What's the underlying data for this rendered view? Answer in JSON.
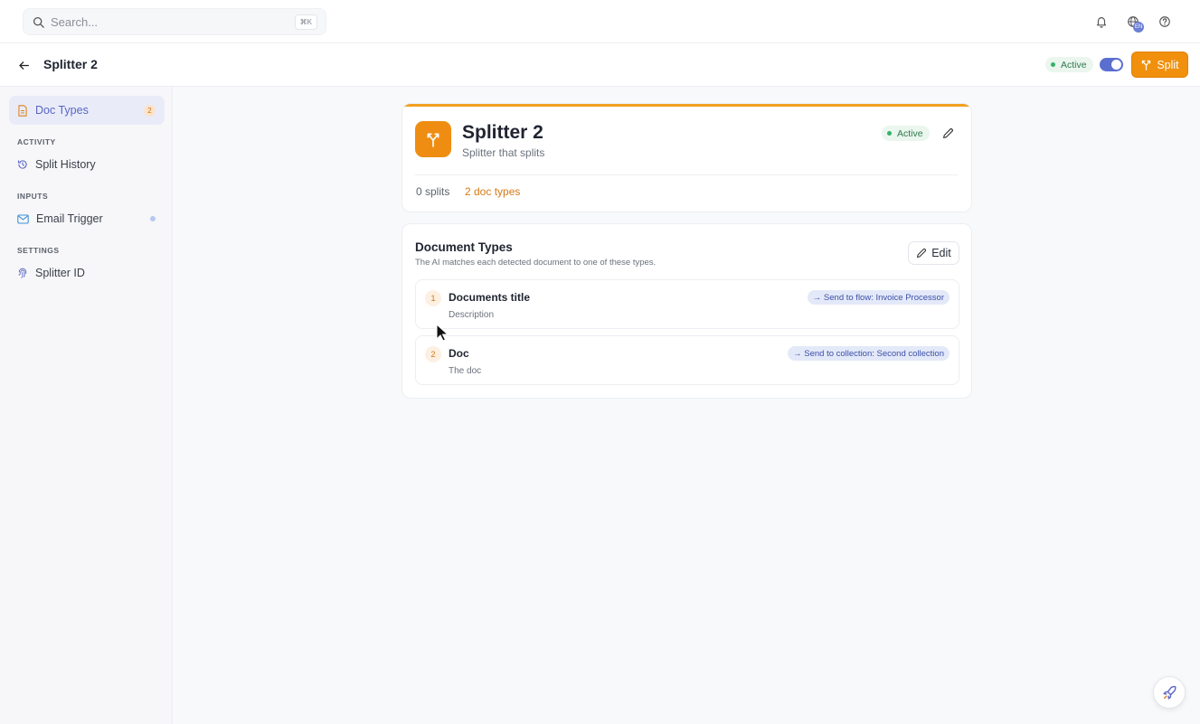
{
  "search": {
    "placeholder": "Search...",
    "shortcut": "⌘K"
  },
  "topbar": {
    "language_badge": "EN"
  },
  "header": {
    "title": "Splitter 2",
    "status": "Active",
    "toggle_on": true,
    "split_label": "Split"
  },
  "sidebar": {
    "items": [
      {
        "label": "Doc Types",
        "count": "2",
        "icon": "document-icon",
        "active": true
      },
      {
        "section": "ACTIVITY",
        "label": "Split History",
        "icon": "history-icon"
      },
      {
        "section": "INPUTS",
        "label": "Email Trigger",
        "icon": "mail-icon"
      },
      {
        "section": "SETTINGS",
        "label": "Splitter ID",
        "icon": "fingerprint-icon"
      }
    ]
  },
  "overview": {
    "title": "Splitter 2",
    "subtitle": "Splitter that splits",
    "status": "Active",
    "splits": "0 splits",
    "doc_types": "2 doc types"
  },
  "document_types": {
    "heading": "Document Types",
    "description": "The AI matches each detected document to one of these types.",
    "edit_label": "Edit",
    "rows": [
      {
        "number": "1",
        "title": "Documents title",
        "description": "Description",
        "route": "→ Send to flow: Invoice Processor"
      },
      {
        "number": "2",
        "title": "Doc",
        "description": "The doc",
        "route": "→ Send to collection: Second collection"
      }
    ]
  },
  "colors": {
    "accent": "#f0900c",
    "brand": "#5865c4",
    "success": "#34b26a"
  }
}
